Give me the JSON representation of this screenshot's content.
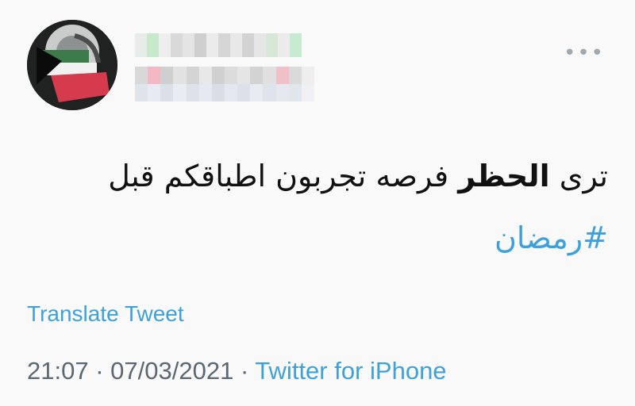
{
  "tweet": {
    "text_before": "ترى ",
    "text_bold": "الحظر",
    "text_after": " فرصه تجربون اطباقكم قبل",
    "hashtag": "#رمضان",
    "translate_label": "Translate Tweet",
    "time": "21:07",
    "separator": "·",
    "date": "07/03/2021",
    "source": "Twitter for iPhone"
  },
  "header": {
    "more_icon": "more-options-icon",
    "more_label": "•••"
  },
  "colors": {
    "link": "#3fa1d9",
    "meta": "#5b6772",
    "text": "#111111"
  }
}
